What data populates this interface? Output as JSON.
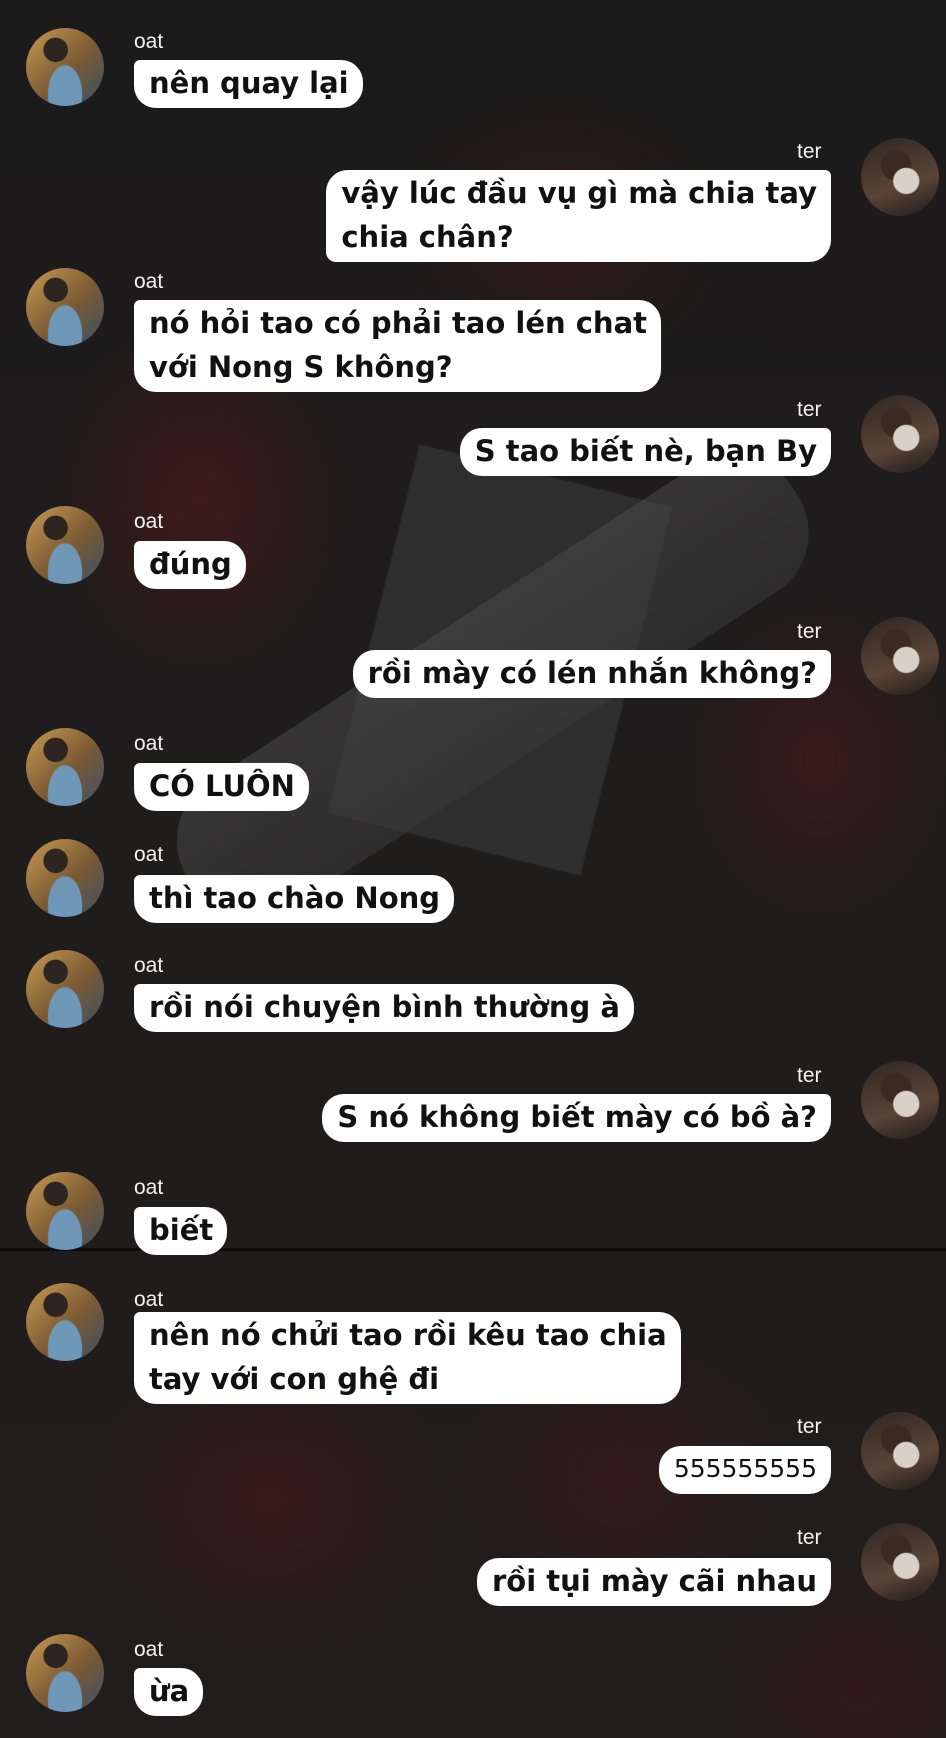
{
  "chat": {
    "participants": {
      "left_name": "oat",
      "right_name": "ter"
    },
    "messages": [
      {
        "sender": "oat",
        "side": "left",
        "text": "nên quay lại"
      },
      {
        "sender": "ter",
        "side": "right",
        "line1": "vậy lúc đầu vụ gì mà chia tay",
        "line2": "chia chân?"
      },
      {
        "sender": "oat",
        "side": "left",
        "line1": "nó hỏi tao có phải tao lén chat",
        "line2": "với Nong S không?"
      },
      {
        "sender": "ter",
        "side": "right",
        "text": "S tao biết nè, bạn By"
      },
      {
        "sender": "oat",
        "side": "left",
        "text": "đúng"
      },
      {
        "sender": "ter",
        "side": "right",
        "text": "rồi mày có lén nhắn không?"
      },
      {
        "sender": "oat",
        "side": "left",
        "text": "CÓ LUÔN"
      },
      {
        "sender": "oat",
        "side": "left",
        "text": "thì tao chào Nong"
      },
      {
        "sender": "oat",
        "side": "left",
        "text": "rồi nói chuyện bình thường à"
      },
      {
        "sender": "ter",
        "side": "right",
        "text": "S nó không biết mày có bồ à?"
      },
      {
        "sender": "oat",
        "side": "left",
        "text": "biết"
      },
      {
        "sender": "oat",
        "side": "left",
        "line1": "nên nó chửi tao rồi kêu tao chia",
        "line2": "tay với con ghệ đi"
      },
      {
        "sender": "ter",
        "side": "right",
        "text": "555555555"
      },
      {
        "sender": "ter",
        "side": "right",
        "text": "rồi tụi mày cãi nhau"
      },
      {
        "sender": "oat",
        "side": "left",
        "text": "ừa"
      }
    ]
  },
  "colors": {
    "bubble": "#ffffff",
    "background": "#1b1a1a",
    "name_text": "#f2f2f2"
  }
}
